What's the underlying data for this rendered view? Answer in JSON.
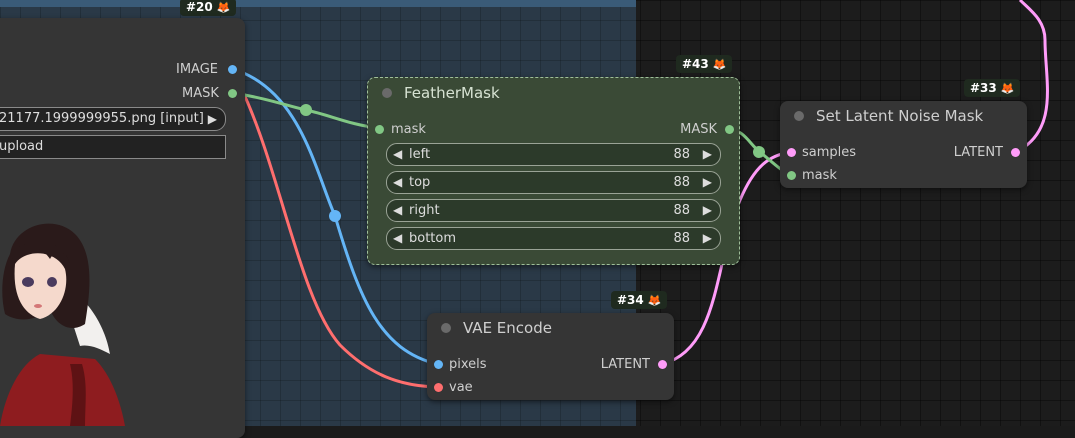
{
  "colors": {
    "image_link": "#64b5f6",
    "mask_link": "#81c784",
    "latent_link": "#ff9cf9",
    "vae_link": "#ff6e6e",
    "group_bg": "#2a3947",
    "node_bg": "#353535",
    "feather_node_bg": "#3a4a36"
  },
  "nodes": {
    "load_image": {
      "badge": "#20",
      "outputs": [
        "IMAGE",
        "MASK"
      ],
      "image_value": "21177.1999999955.png [input]",
      "upload_label": "upload"
    },
    "feather_mask": {
      "badge": "#43",
      "title": "FeatherMask",
      "input_label": "mask",
      "output_label": "MASK",
      "widgets": [
        {
          "label": "left",
          "value": "88"
        },
        {
          "label": "top",
          "value": "88"
        },
        {
          "label": "right",
          "value": "88"
        },
        {
          "label": "bottom",
          "value": "88"
        }
      ]
    },
    "set_latent_noise_mask": {
      "badge": "#33",
      "title": "Set Latent Noise Mask",
      "inputs": [
        "samples",
        "mask"
      ],
      "output_label": "LATENT"
    },
    "vae_encode": {
      "badge": "#34",
      "title": "VAE Encode",
      "inputs": [
        "pixels",
        "vae"
      ],
      "output_label": "LATENT"
    }
  },
  "icons": {
    "badge_icon": "fox-icon",
    "widget_decrement": "◀",
    "widget_increment": "▶",
    "fox_glyph": "🦊"
  }
}
